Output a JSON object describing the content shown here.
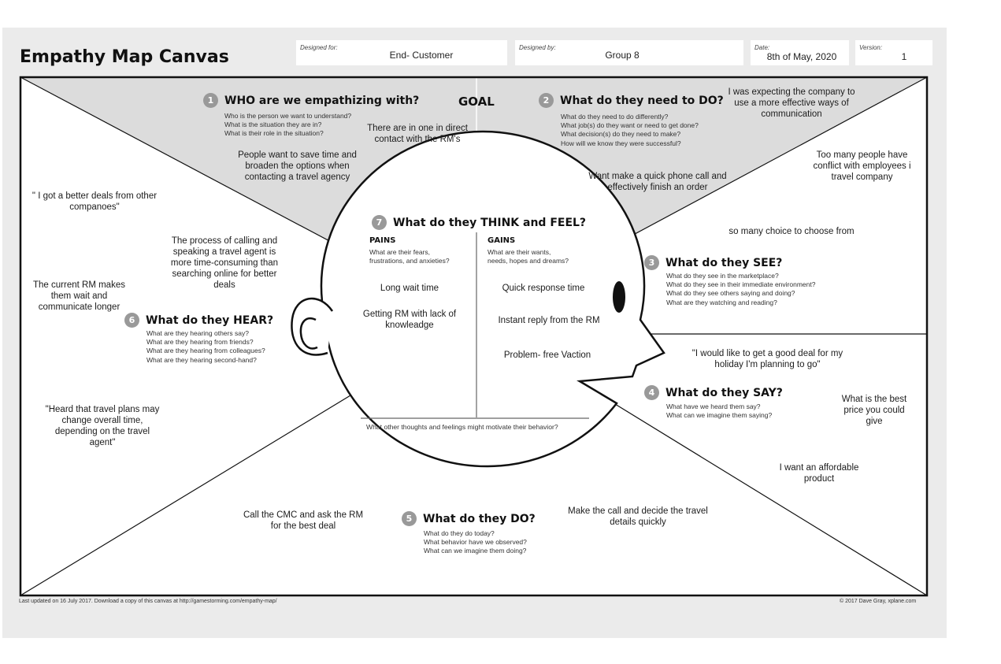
{
  "header": {
    "title": "Empathy Map Canvas",
    "designed_for_label": "Designed for:",
    "designed_for_value": "End- Customer",
    "designed_by_label": "Designed by:",
    "designed_by_value": "Group 8",
    "date_label": "Date:",
    "date_value": "8th of May, 2020",
    "version_label": "Version:",
    "version_value": "1"
  },
  "goal": "GOAL",
  "sections": {
    "who": {
      "number": "1",
      "title": "WHO are we empathizing with?",
      "prompts": [
        "Who is the person we want to understand?",
        "What is the situation they are in?",
        "What is their role in the situation?"
      ]
    },
    "do_need": {
      "number": "2",
      "title": "What do they need to DO?",
      "prompts": [
        "What do they need to do differently?",
        "What job(s) do they want or need to get done?",
        "What decision(s) do they need to make?",
        "How will we know they were successful?"
      ]
    },
    "see": {
      "number": "3",
      "title": "What do they SEE?",
      "prompts": [
        "What do they see in the marketplace?",
        "What do they see in their immediate environment?",
        "What do they see others saying and doing?",
        "What are they watching and reading?"
      ]
    },
    "say": {
      "number": "4",
      "title": "What do they SAY?",
      "prompts": [
        "What have we heard them say?",
        "What can we imagine them saying?"
      ]
    },
    "do": {
      "number": "5",
      "title": "What do they DO?",
      "prompts": [
        "What do they do today?",
        "What behavior have we observed?",
        "What can we imagine them doing?"
      ]
    },
    "hear": {
      "number": "6",
      "title": "What do they HEAR?",
      "prompts": [
        "What are they hearing others say?",
        "What are they hearing from friends?",
        "What are they hearing from colleagues?",
        "What are they hearing second-hand?"
      ]
    },
    "think": {
      "number": "7",
      "title": "What do they THINK and FEEL?",
      "pains_title": "PAINS",
      "pains_prompts": [
        "What are their fears,",
        "frustrations, and anxieties?"
      ],
      "gains_title": "GAINS",
      "gains_prompts": [
        "What are their wants,",
        "needs, hopes and dreams?"
      ],
      "bottom_prompt": "What other thoughts and feelings might motivate their behavior?"
    }
  },
  "notes": {
    "who_1": "There are in one in direct contact with the RM's",
    "who_2": "People want to save time and broaden the options when contacting a travel agency",
    "need_1": "I was expecting the company to use a more effective ways of communication",
    "need_2": "Want make a quick phone call and effectively finish an order",
    "need_3": "Too many people have conflict with employees i travel company",
    "see_1": "so many choice to choose from",
    "say_1": "\"I would like to get  a good deal for my holiday I'm planning to go\"",
    "say_2": "What is the best price you could give",
    "say_3": "I want an affordable product",
    "do_1": "Make the call and decide the travel details quickly",
    "do_2": "Call the CMC and ask the RM for the best deal",
    "hear_1": "\" I got a better deals from other companoes\"",
    "hear_2": "The process of calling and speaking a travel agent is more time-consuming than searching online for better deals",
    "hear_3": "The current  RM makes them wait and communicate longer",
    "hear_4": "\"Heard that travel plans may change overall time, depending on the travel agent\"",
    "pain_1": "Long wait time",
    "pain_2": "Getting RM with lack of knowleadge",
    "gain_1": "Quick response time",
    "gain_2": "Instant reply from the RM",
    "gain_3": "Problem- free Vaction"
  },
  "footer": {
    "left": "Last updated on 16 July 2017. Download a copy of this canvas at http://gamestorming.com/empathy-map/",
    "right": "© 2017 Dave Gray, xplane.com"
  },
  "colors": {
    "background": "#ebebeb",
    "top_wedge": "#dcdcdc",
    "number_circle": "#999999",
    "line": "#111111"
  }
}
